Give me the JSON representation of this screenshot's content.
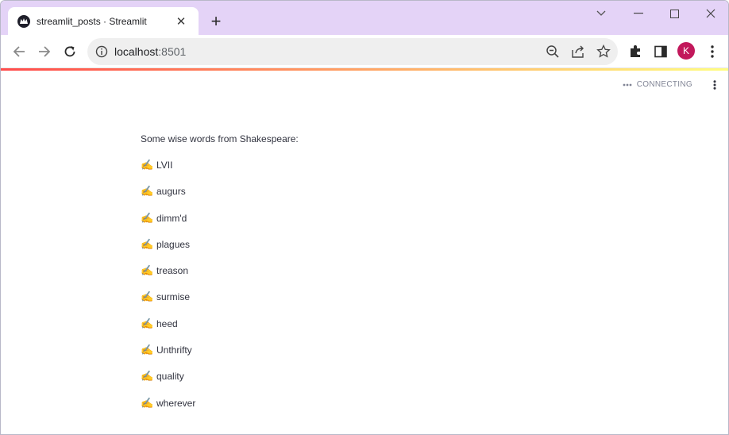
{
  "browser": {
    "tab_title": "streamlit_posts · Streamlit",
    "url_host": "localhost",
    "url_port": ":8501",
    "profile_initial": "K"
  },
  "streamlit": {
    "status": "CONNECTING"
  },
  "content": {
    "intro": "Some wise words from Shakespeare:",
    "emoji": "✍️",
    "words": [
      "LVII",
      "augurs",
      "dimm'd",
      "plagues",
      "treason",
      "surmise",
      "heed",
      "Unthrifty",
      "quality",
      "wherever"
    ]
  },
  "colors": {
    "tabstrip": "#e4d3f7",
    "avatar": "#c2185b",
    "text": "#31333f",
    "decoration_start": "#ff4b4b",
    "decoration_end": "#fffd80"
  }
}
